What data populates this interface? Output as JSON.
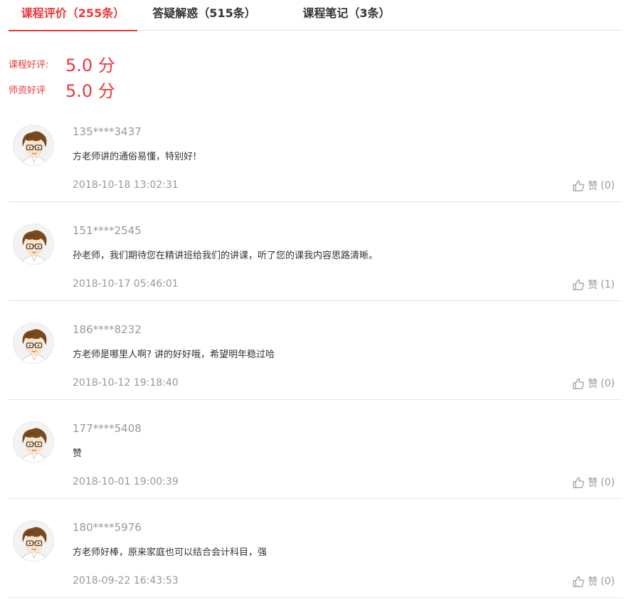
{
  "tabs": [
    {
      "label": "课程评价（255条）",
      "active": true
    },
    {
      "label": "答疑解惑（515条）",
      "active": false
    },
    {
      "label": "课程笔记（3条）",
      "active": false
    }
  ],
  "ratings": {
    "course_label": "课程好评:",
    "course_value": "5.0 分",
    "teacher_label": "师资好评",
    "teacher_value": "5.0 分"
  },
  "reviews": [
    {
      "user": "135****3437",
      "content": "方老师讲的通俗易懂，特别好!",
      "time": "2018-10-18 13:02:31",
      "like_label": "赞",
      "like_count": "(0)",
      "avatar_icon": "cartoon-boy-glasses-avatar"
    },
    {
      "user": "151****2545",
      "content": "孙老师，我们期待您在精讲班给我们的讲课，听了您的课我内容思路清晰。",
      "time": "2018-10-17 05:46:01",
      "like_label": "赞",
      "like_count": "(1)",
      "avatar_icon": "cartoon-boy-glasses-avatar"
    },
    {
      "user": "186****8232",
      "content": "方老师是哪里人啊? 讲的好好哦，希望明年稳过哈",
      "time": "2018-10-12 19:18:40",
      "like_label": "赞",
      "like_count": "(0)",
      "avatar_icon": "cartoon-boy-glasses-avatar"
    },
    {
      "user": "177****5408",
      "content": "赞",
      "time": "2018-10-01 19:00:39",
      "like_label": "赞",
      "like_count": "(0)",
      "avatar_icon": "cartoon-boy-glasses-avatar"
    },
    {
      "user": "180****5976",
      "content": "方老师好棒，原来家庭也可以结合会计科目，强",
      "time": "2018-09-22 16:43:53",
      "like_label": "赞",
      "like_count": "(0)",
      "avatar_icon": "cartoon-boy-glasses-avatar"
    }
  ],
  "colors": {
    "accent": "#e8383d",
    "muted": "#999999",
    "text": "#333333",
    "divider": "#e5e5e5"
  }
}
